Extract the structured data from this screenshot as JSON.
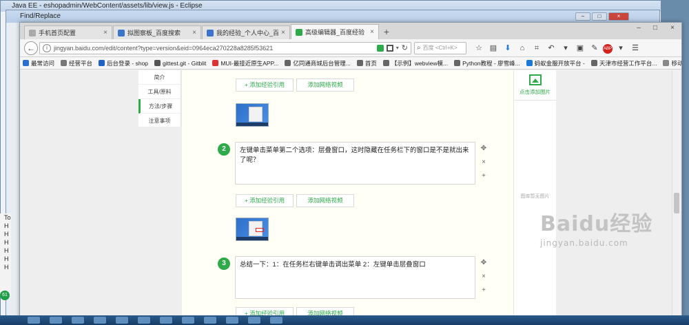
{
  "eclipse_title": "Java EE - eshopadmin/WebContent/assets/lib/view.js - Eclipse",
  "find_title": "Find/Replace",
  "bg_left_letters": [
    "To",
    "H",
    "H",
    "H",
    "H",
    "H",
    "H"
  ],
  "bg_circle": "61",
  "tabs": [
    {
      "label": "手机首页配置",
      "close": "×"
    },
    {
      "label": "拟图察板_百度搜索",
      "close": "×"
    },
    {
      "label": "我的经验_个人中心_百度经验",
      "close": "×"
    },
    {
      "label": "高级编辑器_百度经验",
      "close": "×"
    }
  ],
  "new_tab": "+",
  "url": "jingyan.baidu.com/edit/content?type=version&eid=0964eca270228a8285f53621",
  "search_placeholder": "百度 <Ctrl+K>",
  "bookmarks": [
    "最常访问",
    "经营平台",
    "后台登录 - shop",
    "gittest.git - Gitblit",
    "MUI-最接近原生APP...",
    "亿同通商城后台管理...",
    "首页",
    "【示例】webview模...",
    "Python教程 - 廖雪峰...",
    "蚂蚁金服开放平台 -",
    "天津市经营工作平台..."
  ],
  "bookmark_right": "移动版书签",
  "sidenav": [
    "简介",
    "工具/原料",
    "方法/步骤",
    "注意事项"
  ],
  "buttons": {
    "add_ref": "+ 添加经验引用",
    "add_video": "添加网络视频"
  },
  "steps": [
    {
      "num": "2",
      "text": "左键单击菜单第二个选项：层叠窗口，这时隐藏在任务栏下的窗口是不是就出来了呢？"
    },
    {
      "num": "3",
      "text": "总结一下：1：在任务栏右键单击调出菜单 2：左键单击层叠窗口"
    }
  ],
  "step_controls": {
    "move": "✥",
    "delete": "×",
    "add": "+"
  },
  "right_panel": {
    "add_image": "点击添加图片",
    "empty": "图库暂无图片"
  },
  "watermark": {
    "logo": "Baidu经验",
    "url": "jingyan.baidu.com"
  }
}
